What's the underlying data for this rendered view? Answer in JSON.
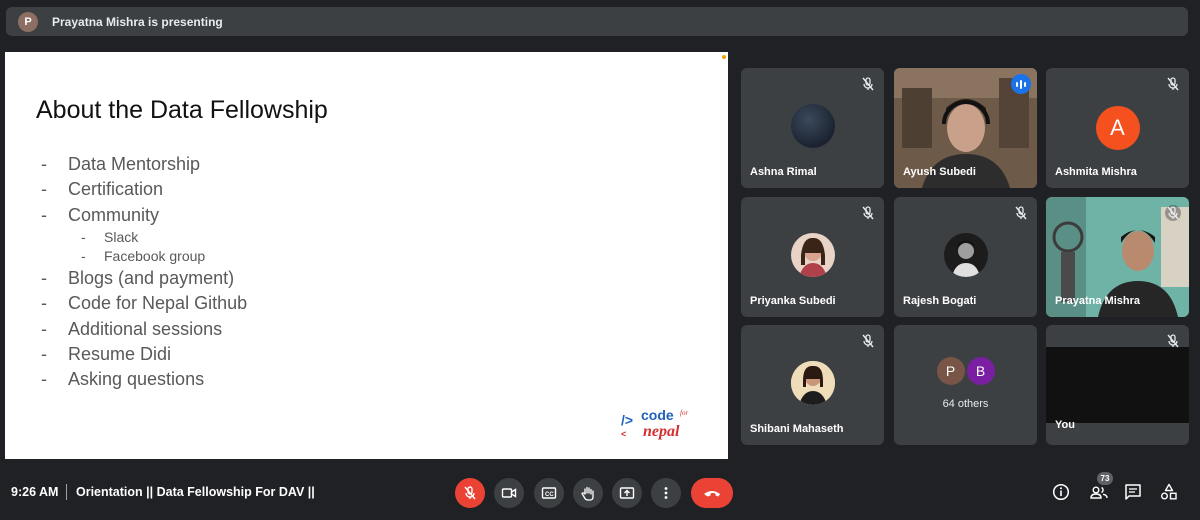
{
  "presenter_banner": {
    "avatar_letter": "P",
    "text": "Prayatna Mishra is presenting"
  },
  "slide": {
    "title": "About the Data Fellowship",
    "bullets": [
      {
        "text": "Data Mentorship",
        "level": 1
      },
      {
        "text": "Certification",
        "level": 1
      },
      {
        "text": "Community",
        "level": 1
      },
      {
        "text": "Slack",
        "level": 2
      },
      {
        "text": "Facebook group",
        "level": 2
      },
      {
        "text": "Blogs (and payment)",
        "level": 1
      },
      {
        "text": "Code for Nepal Github",
        "level": 1
      },
      {
        "text": "Additional sessions",
        "level": 1
      },
      {
        "text": "Resume Didi",
        "level": 1
      },
      {
        "text": "Asking questions",
        "level": 1
      }
    ],
    "logo": {
      "line1": "code",
      "line2": "nepal",
      "small": "for"
    }
  },
  "participants": [
    {
      "name": "Ashna Rimal",
      "muted": true
    },
    {
      "name": "Ayush Subedi",
      "speaking": true
    },
    {
      "name": "Ashmita Mishra",
      "muted": true,
      "letter": "A"
    },
    {
      "name": "Priyanka Subedi",
      "muted": true
    },
    {
      "name": "Rajesh Bogati",
      "muted": true
    },
    {
      "name": "Prayatna Mishra",
      "muted": true
    },
    {
      "name": "Shibani Mahaseth",
      "muted": true
    },
    {
      "name": "64 others",
      "letters": [
        "P",
        "B"
      ]
    },
    {
      "name": "You",
      "muted": true
    }
  ],
  "bottom_bar": {
    "time": "9:26 AM",
    "meeting_title": "Orientation || Data Fellowship For DAV ||",
    "participant_count": "73"
  },
  "colors": {
    "background": "#202124",
    "tile": "#3c4043",
    "red": "#ea4335",
    "active_outline": "#8ab4f8"
  }
}
